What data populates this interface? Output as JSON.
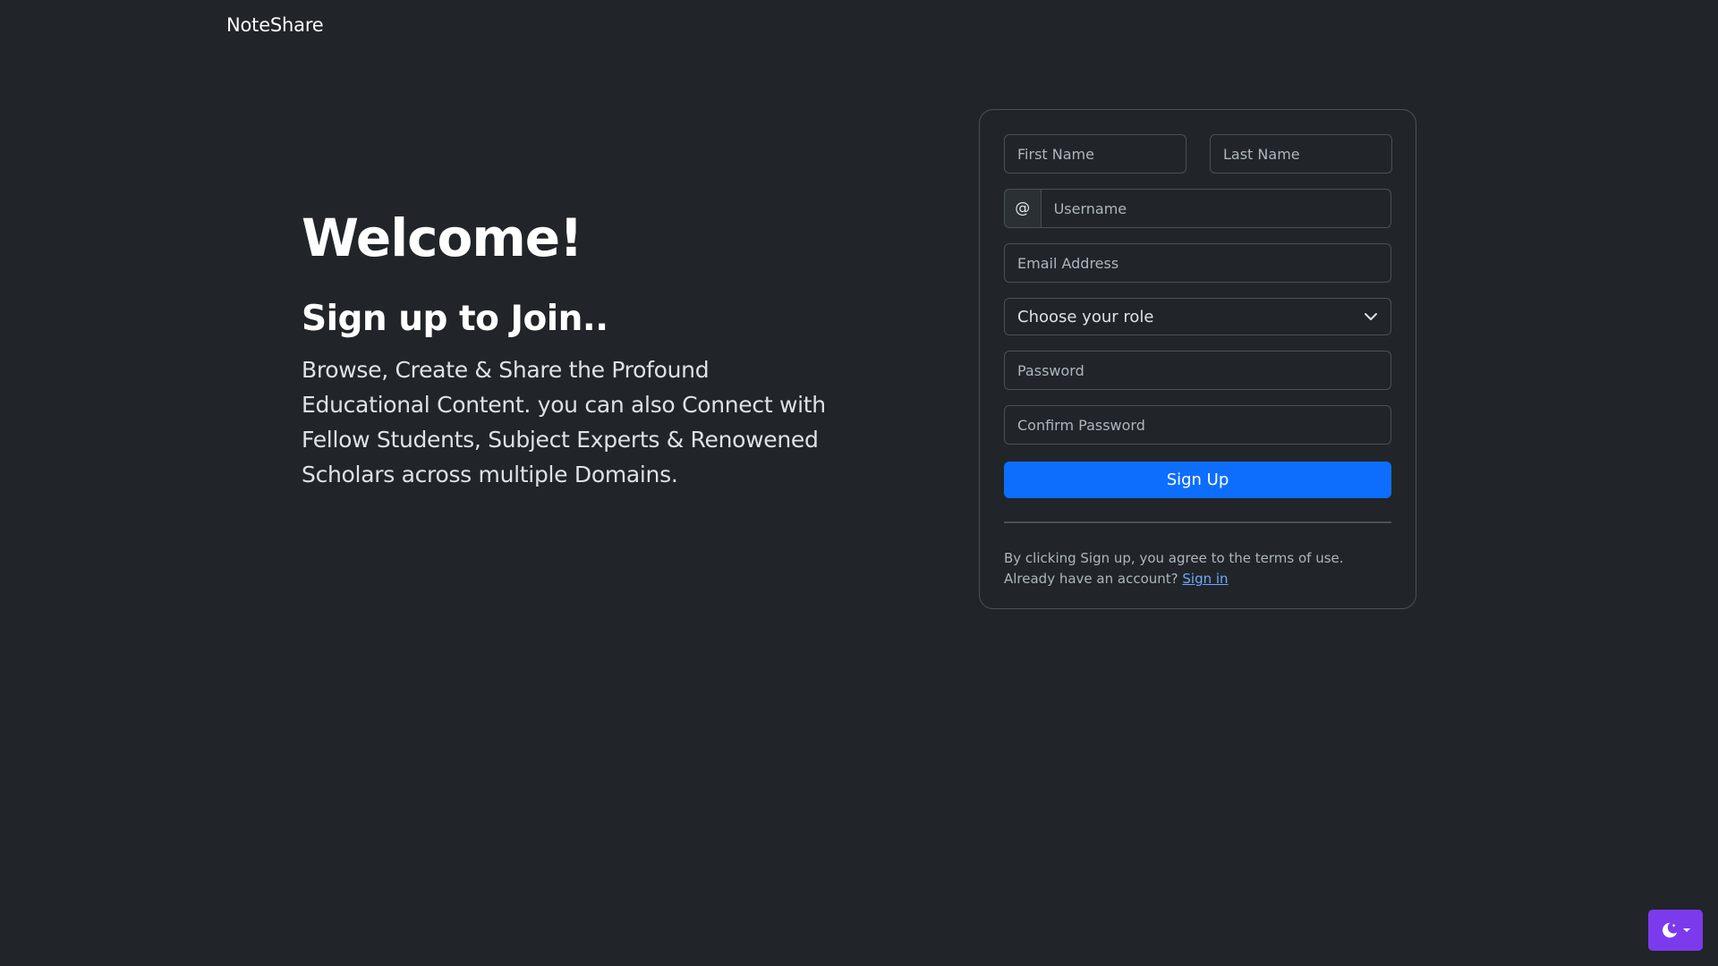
{
  "navbar": {
    "brand": "NoteShare"
  },
  "hero": {
    "title": "Welcome!",
    "subtitle": "Sign up to Join..",
    "description": "Browse, Create & Share the Profound Educational Content. you can also Connect with Fellow Students, Subject Experts & Renowened Scholars across multiple Domains."
  },
  "form": {
    "first_name": {
      "placeholder": "First Name",
      "value": ""
    },
    "last_name": {
      "placeholder": "Last Name",
      "value": ""
    },
    "username": {
      "prefix": "@",
      "placeholder": "Username",
      "value": ""
    },
    "email": {
      "placeholder": "Email Address",
      "value": ""
    },
    "role": {
      "selected": "Choose your role"
    },
    "password": {
      "placeholder": "Password",
      "value": ""
    },
    "confirm_password": {
      "placeholder": "Confirm Password",
      "value": ""
    },
    "submit_label": "Sign Up",
    "terms_text": "By clicking Sign up, you agree to the terms of use.",
    "account_prompt": "Already have an account?",
    "signin_label": "Sign in"
  },
  "theme_toggle": {
    "icon": "moon-icon",
    "color": "#7c3aed"
  },
  "colors": {
    "background": "#212529",
    "primary": "#0d6efd",
    "link": "#6ea8fe"
  }
}
